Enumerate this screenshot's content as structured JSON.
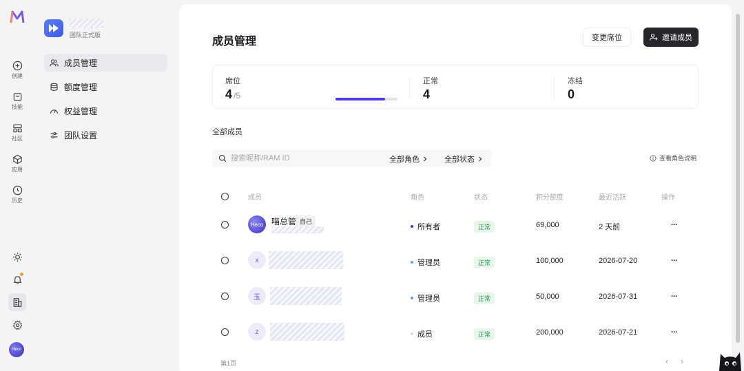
{
  "rail": {
    "items": [
      {
        "label": "创建",
        "icon": "plus-circle-icon"
      },
      {
        "label": "技能",
        "icon": "bag-icon"
      },
      {
        "label": "社区",
        "icon": "grid-icon"
      },
      {
        "label": "应用",
        "icon": "cube-icon"
      },
      {
        "label": "历史",
        "icon": "clock-icon"
      }
    ],
    "avatar_text": "Heco"
  },
  "sidebar": {
    "team_plan": "团队正式版",
    "items": [
      {
        "label": "成员管理",
        "active": true
      },
      {
        "label": "额度管理"
      },
      {
        "label": "权益管理"
      },
      {
        "label": "团队设置"
      }
    ]
  },
  "header": {
    "title": "成员管理",
    "change_seat": "变更席位",
    "invite": "邀请成员"
  },
  "stats": {
    "seats_label": "席位",
    "seats_used": "4",
    "seats_total": "/5",
    "seats_fraction": 0.8,
    "normal_label": "正常",
    "normal_value": "4",
    "frozen_label": "冻结",
    "frozen_value": "0"
  },
  "members_section": {
    "title": "全部成员",
    "search_placeholder": "搜索昵称/RAM ID",
    "role_filter": "全部角色",
    "status_filter": "全部状态",
    "role_help": "查看角色说明"
  },
  "table": {
    "columns": [
      "成员",
      "角色",
      "状态",
      "积分额度",
      "最近活跃",
      "操作"
    ],
    "rows": [
      {
        "avatar": "Heco",
        "name": "喵总管",
        "tag": "自己",
        "role": "所有者",
        "role_color": "#3a35d8",
        "status": "正常",
        "quota": "69,000",
        "last_active": "2 天前"
      },
      {
        "avatar": "x",
        "name": "",
        "tag": "",
        "role": "管理员",
        "role_color": "#6aa0f0",
        "status": "正常",
        "quota": "100,000",
        "last_active": "2026-07-20"
      },
      {
        "avatar": "玉",
        "name": "",
        "tag": "",
        "role": "管理员",
        "role_color": "#6aa0f0",
        "status": "正常",
        "quota": "50,000",
        "last_active": "2026-07-31"
      },
      {
        "avatar": "z",
        "name": "",
        "tag": "",
        "role": "成员",
        "role_color": "#dcdce2",
        "status": "正常",
        "quota": "200,000",
        "last_active": "2026-07-21"
      }
    ],
    "more": "···",
    "pager": "第1页",
    "prev": "‹",
    "next": "›"
  }
}
